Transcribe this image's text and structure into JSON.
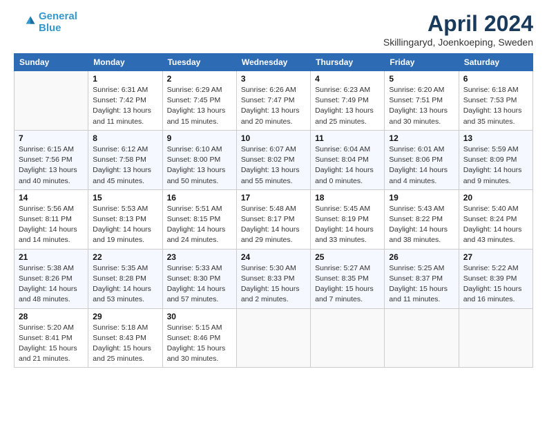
{
  "logo": {
    "line1": "General",
    "line2": "Blue"
  },
  "title": "April 2024",
  "subtitle": "Skillingaryd, Joenkoeping, Sweden",
  "weekdays": [
    "Sunday",
    "Monday",
    "Tuesday",
    "Wednesday",
    "Thursday",
    "Friday",
    "Saturday"
  ],
  "weeks": [
    [
      {
        "day": "",
        "lines": []
      },
      {
        "day": "1",
        "lines": [
          "Sunrise: 6:31 AM",
          "Sunset: 7:42 PM",
          "Daylight: 13 hours",
          "and 11 minutes."
        ]
      },
      {
        "day": "2",
        "lines": [
          "Sunrise: 6:29 AM",
          "Sunset: 7:45 PM",
          "Daylight: 13 hours",
          "and 15 minutes."
        ]
      },
      {
        "day": "3",
        "lines": [
          "Sunrise: 6:26 AM",
          "Sunset: 7:47 PM",
          "Daylight: 13 hours",
          "and 20 minutes."
        ]
      },
      {
        "day": "4",
        "lines": [
          "Sunrise: 6:23 AM",
          "Sunset: 7:49 PM",
          "Daylight: 13 hours",
          "and 25 minutes."
        ]
      },
      {
        "day": "5",
        "lines": [
          "Sunrise: 6:20 AM",
          "Sunset: 7:51 PM",
          "Daylight: 13 hours",
          "and 30 minutes."
        ]
      },
      {
        "day": "6",
        "lines": [
          "Sunrise: 6:18 AM",
          "Sunset: 7:53 PM",
          "Daylight: 13 hours",
          "and 35 minutes."
        ]
      }
    ],
    [
      {
        "day": "7",
        "lines": [
          "Sunrise: 6:15 AM",
          "Sunset: 7:56 PM",
          "Daylight: 13 hours",
          "and 40 minutes."
        ]
      },
      {
        "day": "8",
        "lines": [
          "Sunrise: 6:12 AM",
          "Sunset: 7:58 PM",
          "Daylight: 13 hours",
          "and 45 minutes."
        ]
      },
      {
        "day": "9",
        "lines": [
          "Sunrise: 6:10 AM",
          "Sunset: 8:00 PM",
          "Daylight: 13 hours",
          "and 50 minutes."
        ]
      },
      {
        "day": "10",
        "lines": [
          "Sunrise: 6:07 AM",
          "Sunset: 8:02 PM",
          "Daylight: 13 hours",
          "and 55 minutes."
        ]
      },
      {
        "day": "11",
        "lines": [
          "Sunrise: 6:04 AM",
          "Sunset: 8:04 PM",
          "Daylight: 14 hours",
          "and 0 minutes."
        ]
      },
      {
        "day": "12",
        "lines": [
          "Sunrise: 6:01 AM",
          "Sunset: 8:06 PM",
          "Daylight: 14 hours",
          "and 4 minutes."
        ]
      },
      {
        "day": "13",
        "lines": [
          "Sunrise: 5:59 AM",
          "Sunset: 8:09 PM",
          "Daylight: 14 hours",
          "and 9 minutes."
        ]
      }
    ],
    [
      {
        "day": "14",
        "lines": [
          "Sunrise: 5:56 AM",
          "Sunset: 8:11 PM",
          "Daylight: 14 hours",
          "and 14 minutes."
        ]
      },
      {
        "day": "15",
        "lines": [
          "Sunrise: 5:53 AM",
          "Sunset: 8:13 PM",
          "Daylight: 14 hours",
          "and 19 minutes."
        ]
      },
      {
        "day": "16",
        "lines": [
          "Sunrise: 5:51 AM",
          "Sunset: 8:15 PM",
          "Daylight: 14 hours",
          "and 24 minutes."
        ]
      },
      {
        "day": "17",
        "lines": [
          "Sunrise: 5:48 AM",
          "Sunset: 8:17 PM",
          "Daylight: 14 hours",
          "and 29 minutes."
        ]
      },
      {
        "day": "18",
        "lines": [
          "Sunrise: 5:45 AM",
          "Sunset: 8:19 PM",
          "Daylight: 14 hours",
          "and 33 minutes."
        ]
      },
      {
        "day": "19",
        "lines": [
          "Sunrise: 5:43 AM",
          "Sunset: 8:22 PM",
          "Daylight: 14 hours",
          "and 38 minutes."
        ]
      },
      {
        "day": "20",
        "lines": [
          "Sunrise: 5:40 AM",
          "Sunset: 8:24 PM",
          "Daylight: 14 hours",
          "and 43 minutes."
        ]
      }
    ],
    [
      {
        "day": "21",
        "lines": [
          "Sunrise: 5:38 AM",
          "Sunset: 8:26 PM",
          "Daylight: 14 hours",
          "and 48 minutes."
        ]
      },
      {
        "day": "22",
        "lines": [
          "Sunrise: 5:35 AM",
          "Sunset: 8:28 PM",
          "Daylight: 14 hours",
          "and 53 minutes."
        ]
      },
      {
        "day": "23",
        "lines": [
          "Sunrise: 5:33 AM",
          "Sunset: 8:30 PM",
          "Daylight: 14 hours",
          "and 57 minutes."
        ]
      },
      {
        "day": "24",
        "lines": [
          "Sunrise: 5:30 AM",
          "Sunset: 8:33 PM",
          "Daylight: 15 hours",
          "and 2 minutes."
        ]
      },
      {
        "day": "25",
        "lines": [
          "Sunrise: 5:27 AM",
          "Sunset: 8:35 PM",
          "Daylight: 15 hours",
          "and 7 minutes."
        ]
      },
      {
        "day": "26",
        "lines": [
          "Sunrise: 5:25 AM",
          "Sunset: 8:37 PM",
          "Daylight: 15 hours",
          "and 11 minutes."
        ]
      },
      {
        "day": "27",
        "lines": [
          "Sunrise: 5:22 AM",
          "Sunset: 8:39 PM",
          "Daylight: 15 hours",
          "and 16 minutes."
        ]
      }
    ],
    [
      {
        "day": "28",
        "lines": [
          "Sunrise: 5:20 AM",
          "Sunset: 8:41 PM",
          "Daylight: 15 hours",
          "and 21 minutes."
        ]
      },
      {
        "day": "29",
        "lines": [
          "Sunrise: 5:18 AM",
          "Sunset: 8:43 PM",
          "Daylight: 15 hours",
          "and 25 minutes."
        ]
      },
      {
        "day": "30",
        "lines": [
          "Sunrise: 5:15 AM",
          "Sunset: 8:46 PM",
          "Daylight: 15 hours",
          "and 30 minutes."
        ]
      },
      {
        "day": "",
        "lines": []
      },
      {
        "day": "",
        "lines": []
      },
      {
        "day": "",
        "lines": []
      },
      {
        "day": "",
        "lines": []
      }
    ]
  ]
}
